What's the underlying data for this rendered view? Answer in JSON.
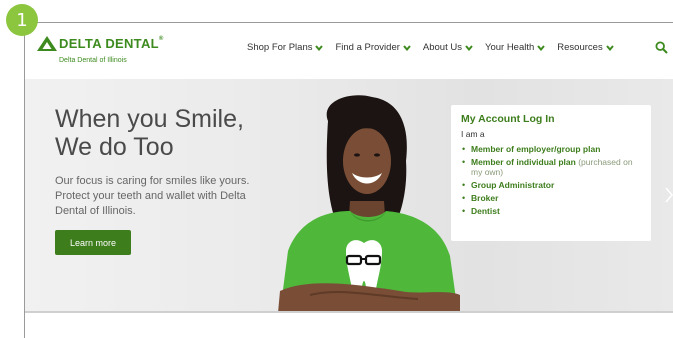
{
  "step_badge": "1",
  "brand": {
    "name": "DELTA DENTAL",
    "registered": "®",
    "subtitle": "Delta Dental of Illinois",
    "color": "#3d8b1f"
  },
  "nav": {
    "items": [
      {
        "label": "Shop For Plans"
      },
      {
        "label": "Find a Provider"
      },
      {
        "label": "About Us"
      },
      {
        "label": "Your Health"
      },
      {
        "label": "Resources"
      }
    ],
    "search_icon": "search-icon"
  },
  "hero": {
    "title_line1": "When you Smile,",
    "title_line2": "We do Too",
    "description": "Our focus is caring for smiles like yours. Protect your teeth and wallet with Delta Dental of Illinois.",
    "button_label": "Learn more"
  },
  "account": {
    "title": "My Account Log In",
    "subtitle": "I am a",
    "items": [
      {
        "label": "Member of employer/group plan",
        "note": ""
      },
      {
        "label": "Member of individual plan",
        "note": "(purchased on my own)"
      },
      {
        "label": "Group Administrator",
        "note": ""
      },
      {
        "label": "Broker",
        "note": ""
      },
      {
        "label": "Dentist",
        "note": ""
      }
    ]
  },
  "colors": {
    "accent_green": "#3d7d1c",
    "badge_green": "#8cc63f",
    "shirt_green": "#4fb83a"
  }
}
